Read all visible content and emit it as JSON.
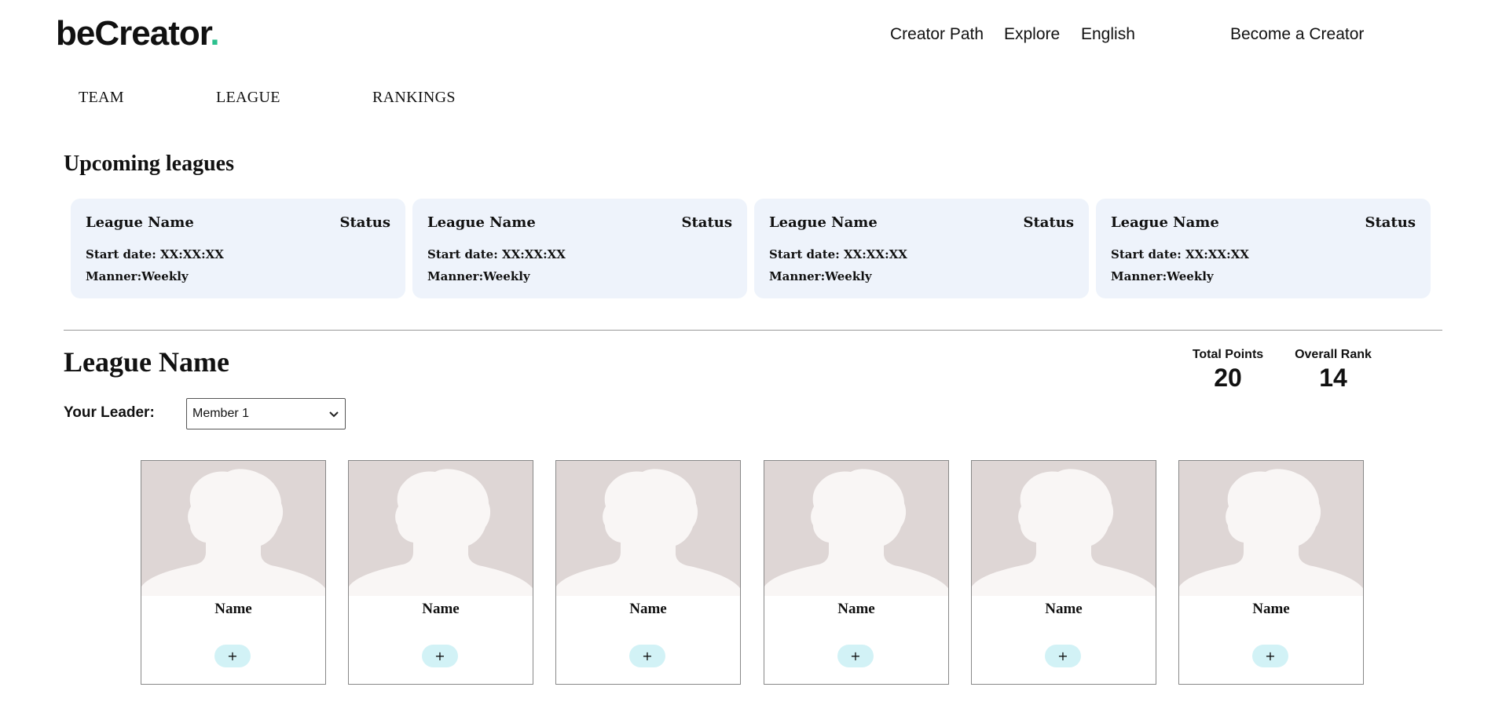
{
  "brand": {
    "name": "beCreator",
    "dot": ".",
    "dot_color": "#2cc08e"
  },
  "topnav": {
    "creator_path": "Creator Path",
    "explore": "Explore",
    "language": "English",
    "become_creator": "Become a Creator"
  },
  "subnav": {
    "team": "TEAM",
    "league": "LEAGUE",
    "rankings": "RANKINGS"
  },
  "upcoming": {
    "title": "Upcoming leagues",
    "cards": [
      {
        "name": "League Name",
        "status": "Status",
        "start": "Start date: XX:XX:XX",
        "manner": "Manner:Weekly"
      },
      {
        "name": "League Name",
        "status": "Status",
        "start": "Start date: XX:XX:XX",
        "manner": "Manner:Weekly"
      },
      {
        "name": "League Name",
        "status": "Status",
        "start": "Start date: XX:XX:XX",
        "manner": "Manner:Weekly"
      },
      {
        "name": "League Name",
        "status": "Status",
        "start": "Start date: XX:XX:XX",
        "manner": "Manner:Weekly"
      }
    ]
  },
  "league": {
    "title": "League Name",
    "leader_label": "Your Leader:",
    "leader_value": "Member 1",
    "total_points_label": "Total Points",
    "total_points": "20",
    "overall_rank_label": "Overall Rank",
    "overall_rank": "14"
  },
  "members": [
    {
      "name": "Name",
      "add": "+"
    },
    {
      "name": "Name",
      "add": "+"
    },
    {
      "name": "Name",
      "add": "+"
    },
    {
      "name": "Name",
      "add": "+"
    },
    {
      "name": "Name",
      "add": "+"
    },
    {
      "name": "Name",
      "add": "+"
    }
  ],
  "icons": {
    "avatar": "person-silhouette-icon",
    "dropdown": "chevron-down-icon"
  },
  "colors": {
    "card_bg": "#eef3fb",
    "photo_bg": "#ded6d5",
    "add_button": "#d2f2f6"
  }
}
